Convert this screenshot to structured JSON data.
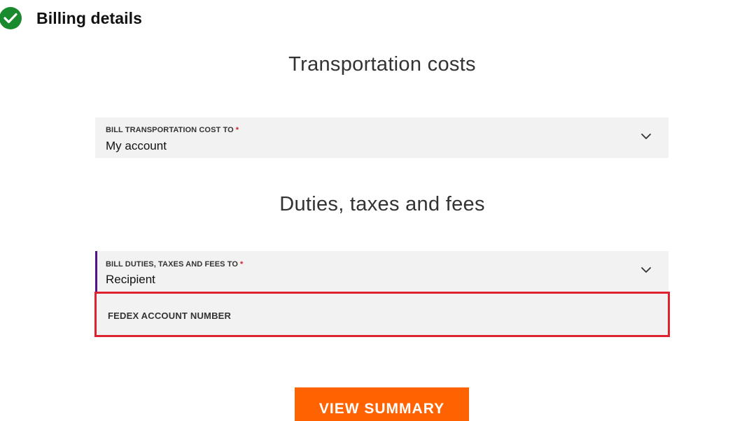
{
  "section": {
    "title": "Billing details",
    "icon": "check-circle-icon",
    "icon_color": "#1a8a2e"
  },
  "transportation": {
    "heading": "Transportation costs",
    "select": {
      "label": "BILL TRANSPORTATION COST TO",
      "required_mark": "*",
      "value": "My account",
      "icon": "chevron-down-icon"
    }
  },
  "duties": {
    "heading": "Duties, taxes and fees",
    "select": {
      "label": "BILL DUTIES, TAXES AND FEES TO",
      "required_mark": "*",
      "value": "Recipient",
      "icon": "chevron-down-icon",
      "focus_color": "#4d148c"
    },
    "account_field": {
      "label": "FEDEX ACCOUNT NUMBER",
      "highlight_color": "#de2230"
    }
  },
  "actions": {
    "view_summary_label": "VIEW SUMMARY",
    "button_color": "#ff6200"
  },
  "colors": {
    "required": "#d01e2f",
    "field_background": "#f2f2f2"
  }
}
